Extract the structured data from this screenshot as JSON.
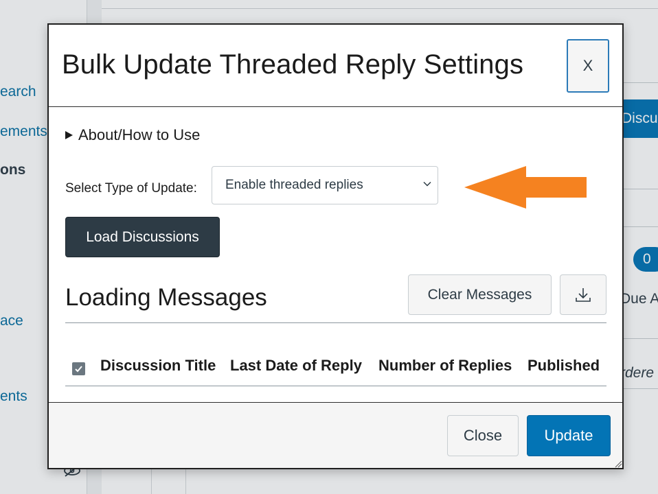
{
  "background": {
    "nav_items": [
      "earch",
      "ements",
      "ons",
      "ace",
      "ents"
    ],
    "right_button_label": "Discus",
    "right_pill_count": "0",
    "right_text_due": "Due A",
    "right_text_ordered": "rdere"
  },
  "modal": {
    "title": "Bulk Update Threaded Reply Settings",
    "close_x_label": "X",
    "about_label": "About/How to Use",
    "select_label": "Select Type of Update:",
    "select_value": "Enable threaded replies",
    "load_button_label": "Load Discussions",
    "section_heading": "Loading Messages",
    "clear_button_label": "Clear Messages",
    "table_headers": [
      "Discussion Title",
      "Last Date of Reply",
      "Number of Replies",
      "Published"
    ],
    "footer_close_label": "Close",
    "footer_update_label": "Update"
  },
  "icons": {
    "download": "download-icon",
    "arrow": "orange-arrow-icon",
    "chevron": "chevron-down-icon",
    "eye": "eye-slash-icon"
  },
  "colors": {
    "primary": "#0374b5",
    "dark_button": "#2d3b45",
    "annotation_arrow": "#f58220"
  }
}
